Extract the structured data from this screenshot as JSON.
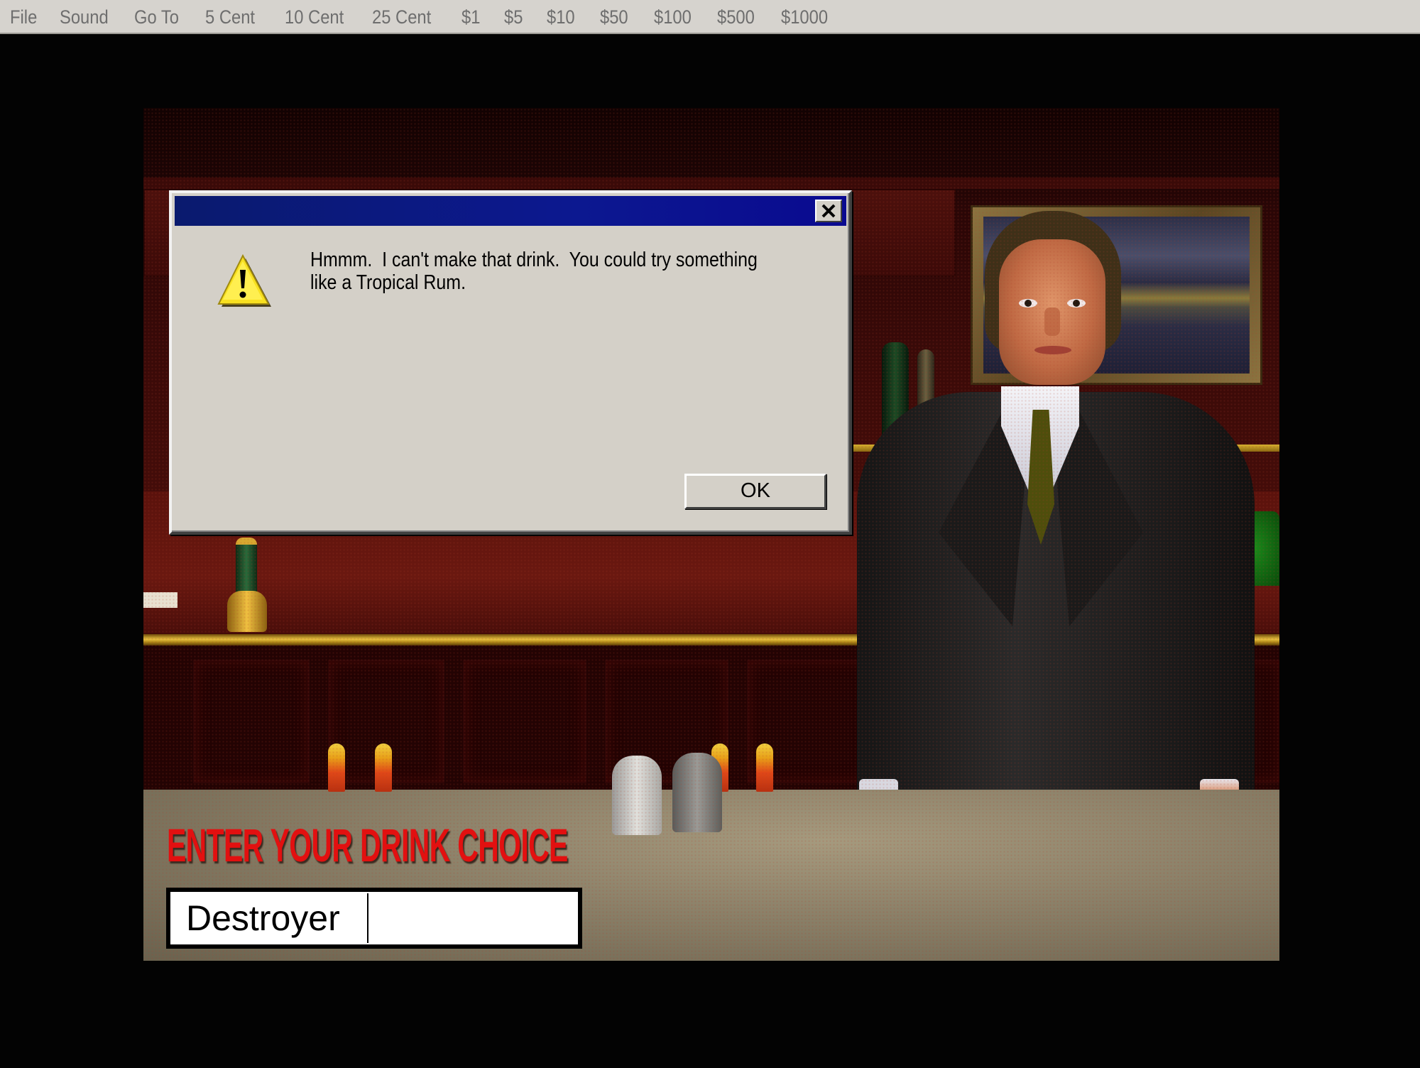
{
  "menubar": {
    "items": [
      "File",
      "Sound",
      "Go To",
      "5 Cent",
      "10 Cent",
      "25 Cent",
      "$1",
      "$5",
      "$10",
      "$50",
      "$100",
      "$500",
      "$1000"
    ]
  },
  "scene": {
    "description": "3D rendered bar with bartender in dark suit and olive tie",
    "icons": {
      "painting": "landscape-painting",
      "tap": "beer-tap",
      "bottles": "liquor-bottles",
      "candles": "candles",
      "shakers": "salt-pepper-shakers",
      "plant": "potted-plant"
    },
    "bottle_colors": [
      "#d8d4b0",
      "#c84a1a",
      "#c8c8a0",
      "#c8a428",
      "#3a2a7a",
      "#0c2a14",
      "#9a9a60",
      "#b89a2a",
      "#8a8aa8",
      "#1a1a10"
    ]
  },
  "prompt": {
    "label": "ENTER YOUR DRINK CHOICE",
    "input_value": "Destroyer",
    "label_color": "#e21010"
  },
  "dialog": {
    "title": "",
    "icon": "warning-icon",
    "message_line1": "Hmmm.  I can't make that drink.  You could try something",
    "message_line2": "like a Tropical Rum.",
    "ok_label": "OK",
    "close_label": "×",
    "titlebar_color": "#0c1890"
  }
}
